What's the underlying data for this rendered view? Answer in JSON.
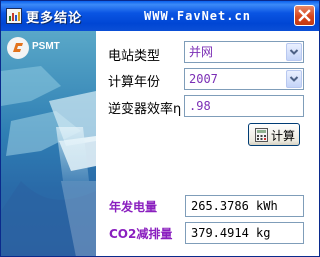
{
  "window": {
    "title": "更多结论",
    "brand": "WWW.FavNet.cn"
  },
  "left_panel": {
    "logo_text": "PSMT"
  },
  "form": {
    "station_type_label": "电站类型",
    "station_type_value": "并网",
    "year_label": "计算年份",
    "year_value": "2007",
    "efficiency_label": "逆变器效率η",
    "efficiency_value": ".98",
    "calc_button_label": "计算"
  },
  "results": {
    "annual_output_label": "年发电量",
    "annual_output_value": "265.3786 kWh",
    "co2_label": "CO2减排量",
    "co2_value": "379.4914 kg"
  },
  "colors": {
    "titlebar": "#0054e3",
    "result_label": "#8a1fbf",
    "input_text": "#7b2fb5"
  }
}
